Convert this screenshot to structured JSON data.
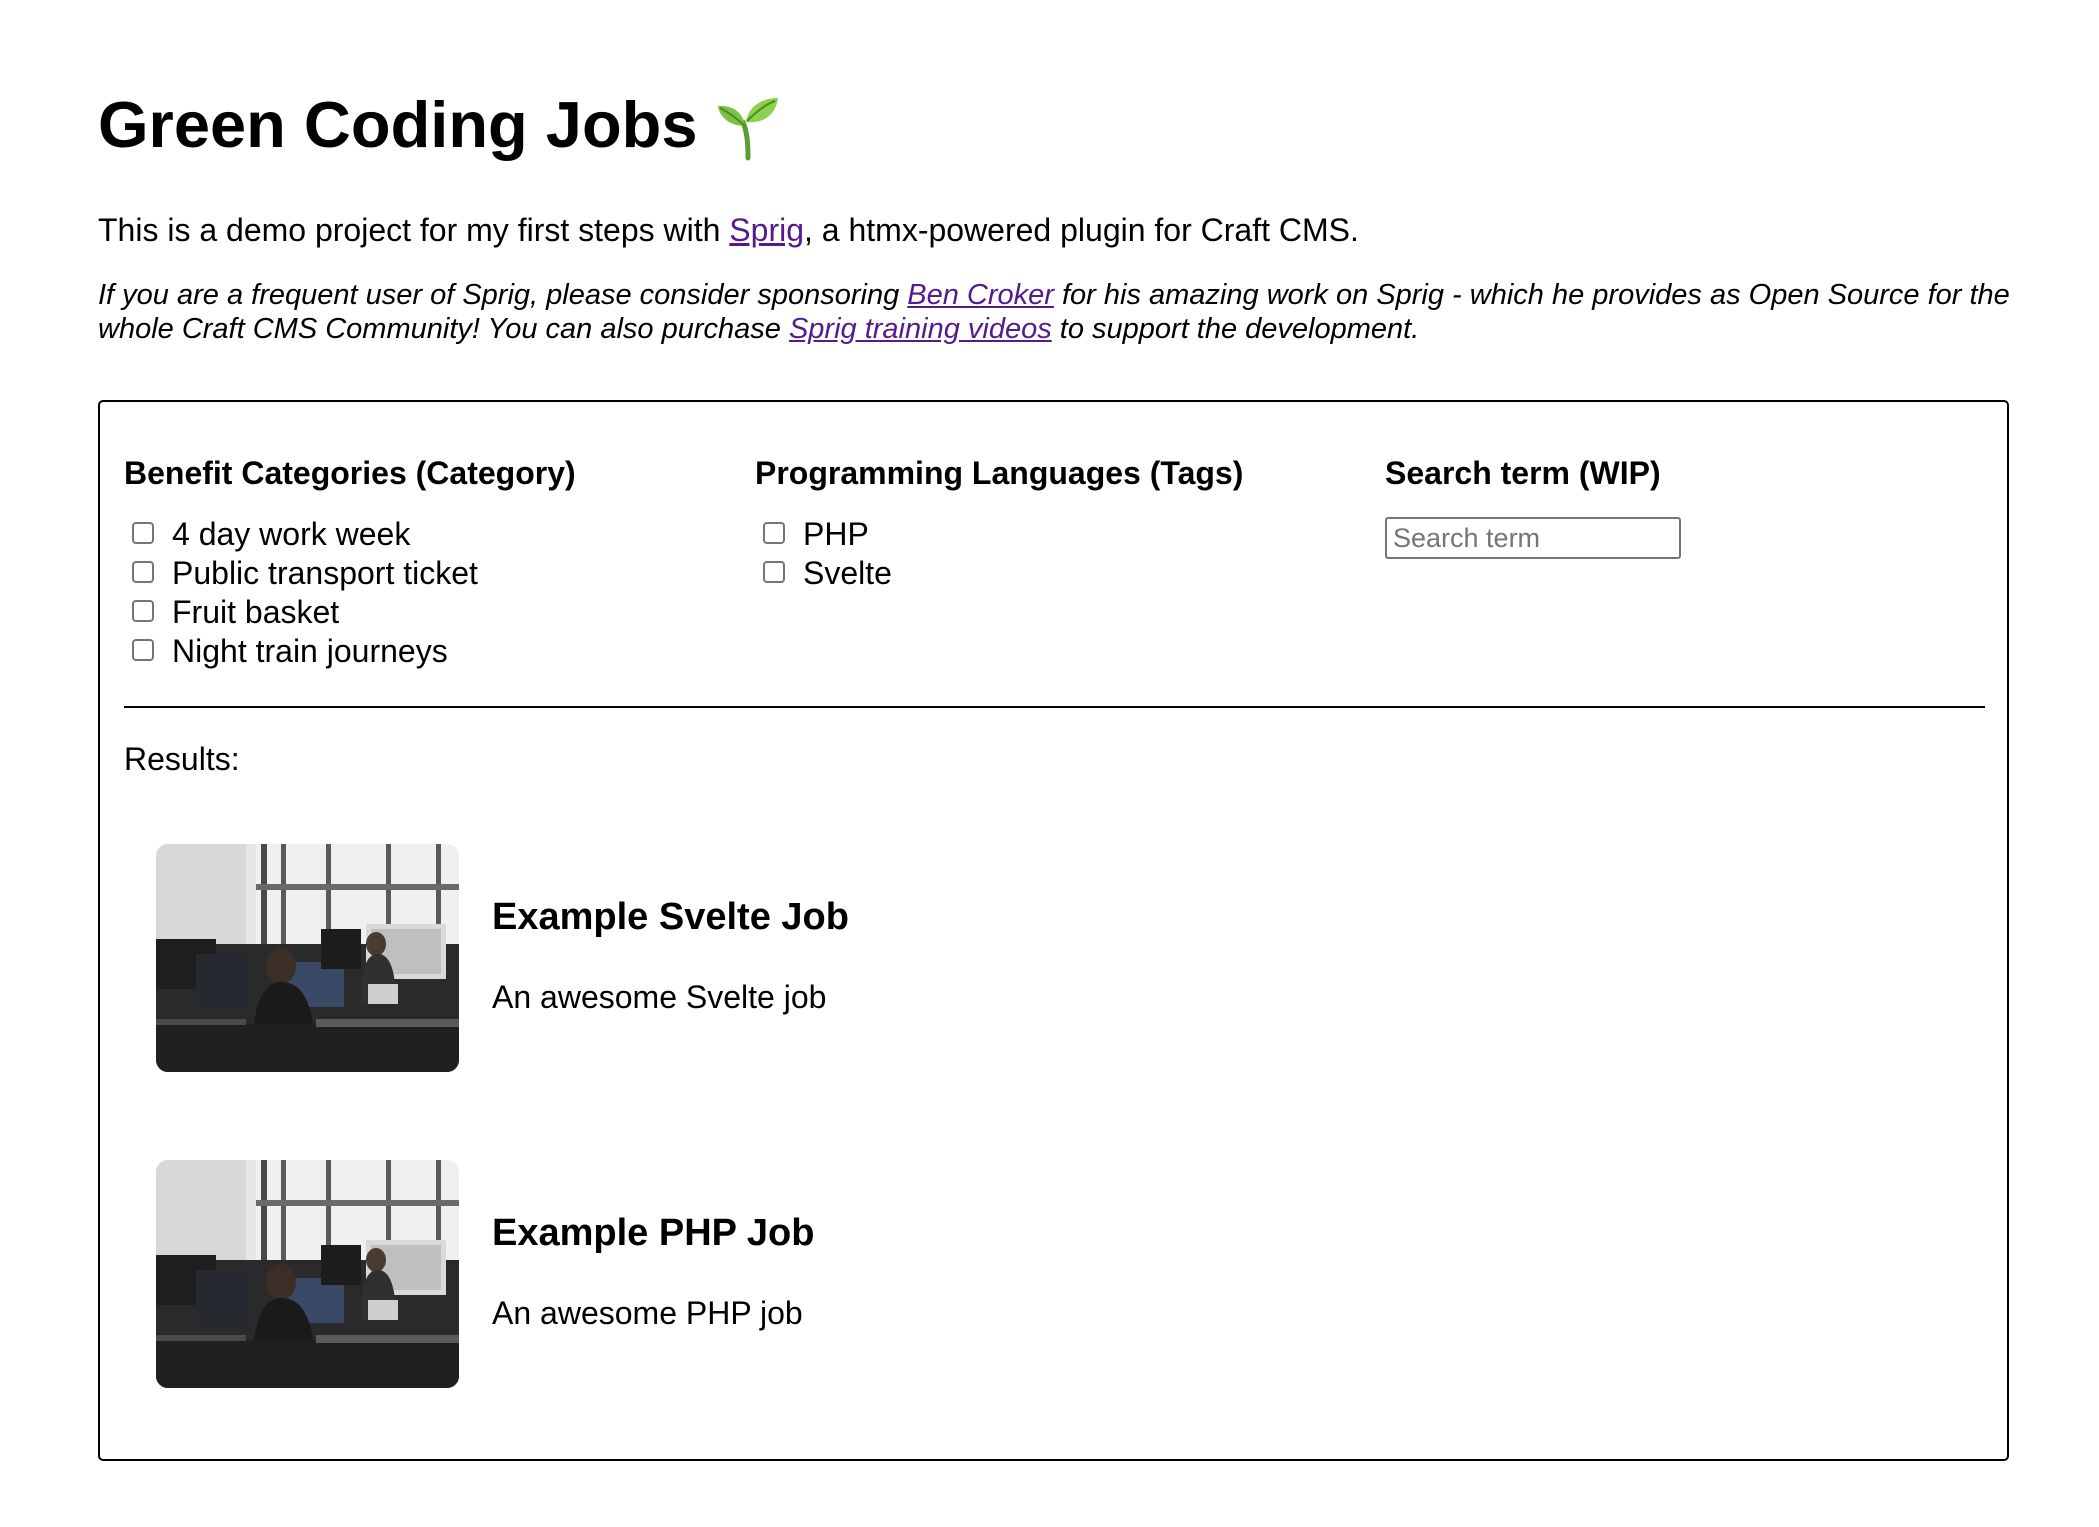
{
  "header": {
    "title": "Green Coding Jobs",
    "title_icon": "seedling-icon"
  },
  "intro": {
    "before": "This is a demo project for my first steps with ",
    "link": "Sprig",
    "after": ", a htmx-powered plugin for Craft CMS."
  },
  "note": {
    "part1": "If you are a frequent user of Sprig, please consider sponsoring ",
    "link1": "Ben Croker",
    "part2": " for his amazing work on Sprig - which he provides as Open Source for the whole Craft CMS Community! You can also purchase ",
    "link2": "Sprig training videos",
    "part3": " to support the development."
  },
  "filters": {
    "benefits": {
      "heading": "Benefit Categories (Category)",
      "options": [
        {
          "label": "4 day work week",
          "checked": false
        },
        {
          "label": "Public transport ticket",
          "checked": false
        },
        {
          "label": "Fruit basket",
          "checked": false
        },
        {
          "label": "Night train journeys",
          "checked": false
        }
      ]
    },
    "languages": {
      "heading": "Programming Languages (Tags)",
      "options": [
        {
          "label": "PHP",
          "checked": false
        },
        {
          "label": "Svelte",
          "checked": false
        }
      ]
    },
    "search": {
      "heading": "Search term (WIP)",
      "placeholder": "Search term",
      "value": ""
    }
  },
  "results": {
    "label": "Results:",
    "jobs": [
      {
        "title": "Example Svelte Job",
        "description": "An awesome Svelte job",
        "image": "office-photo"
      },
      {
        "title": "Example PHP Job",
        "description": "An awesome PHP job",
        "image": "office-photo"
      }
    ]
  },
  "colors": {
    "link": "#551a8b",
    "text": "#000000",
    "border": "#000000"
  }
}
